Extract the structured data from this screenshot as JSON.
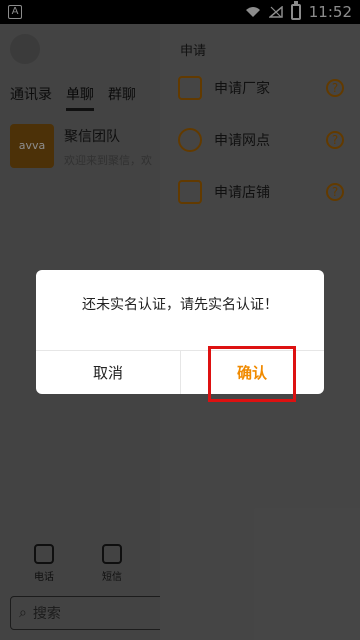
{
  "status": {
    "time": "11:52",
    "left_icon": "A"
  },
  "app": {
    "tabs": [
      "通讯录",
      "单聊",
      "群聊"
    ],
    "active_tab": "单聊",
    "chat": {
      "title": "聚信团队",
      "subtitle": "欢迎来到聚信，欢",
      "logo_text": "avva"
    },
    "bottom_nav": [
      {
        "label": "电话",
        "icon": "phone-icon"
      },
      {
        "label": "短信",
        "icon": "mail-icon"
      }
    ],
    "search_placeholder": "搜索"
  },
  "drawer": {
    "title": "申请",
    "items": [
      {
        "label": "申请厂家",
        "icon": "building-icon"
      },
      {
        "label": "申请网点",
        "icon": "network-icon"
      },
      {
        "label": "申请店铺",
        "icon": "store-icon"
      }
    ]
  },
  "dialog": {
    "message": "还未实名认证，请先实名认证！",
    "cancel_label": "取消",
    "confirm_label": "确认"
  },
  "colors": {
    "accent": "#f08a00",
    "icon": "#b26b00",
    "highlight": "#dd1111"
  }
}
